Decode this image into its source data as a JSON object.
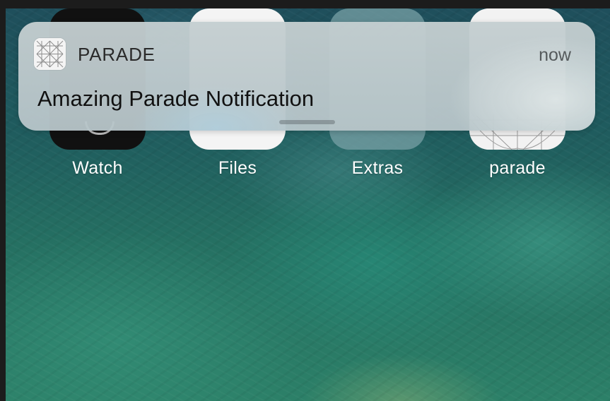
{
  "notification": {
    "app_name": "PARADE",
    "time": "now",
    "message": "Amazing Parade Notification",
    "app_icon": "parade-grid-icon"
  },
  "home_screen": {
    "apps": [
      {
        "label": "Watch",
        "icon": "watch-icon"
      },
      {
        "label": "Files",
        "icon": "files-icon"
      },
      {
        "label": "Extras",
        "icon": "extras-folder-icon"
      },
      {
        "label": "parade",
        "icon": "parade-app-icon"
      }
    ]
  },
  "colors": {
    "label_text": "#ffffff",
    "notification_background": "#c4cecf",
    "wallpaper_base": "#257062"
  }
}
